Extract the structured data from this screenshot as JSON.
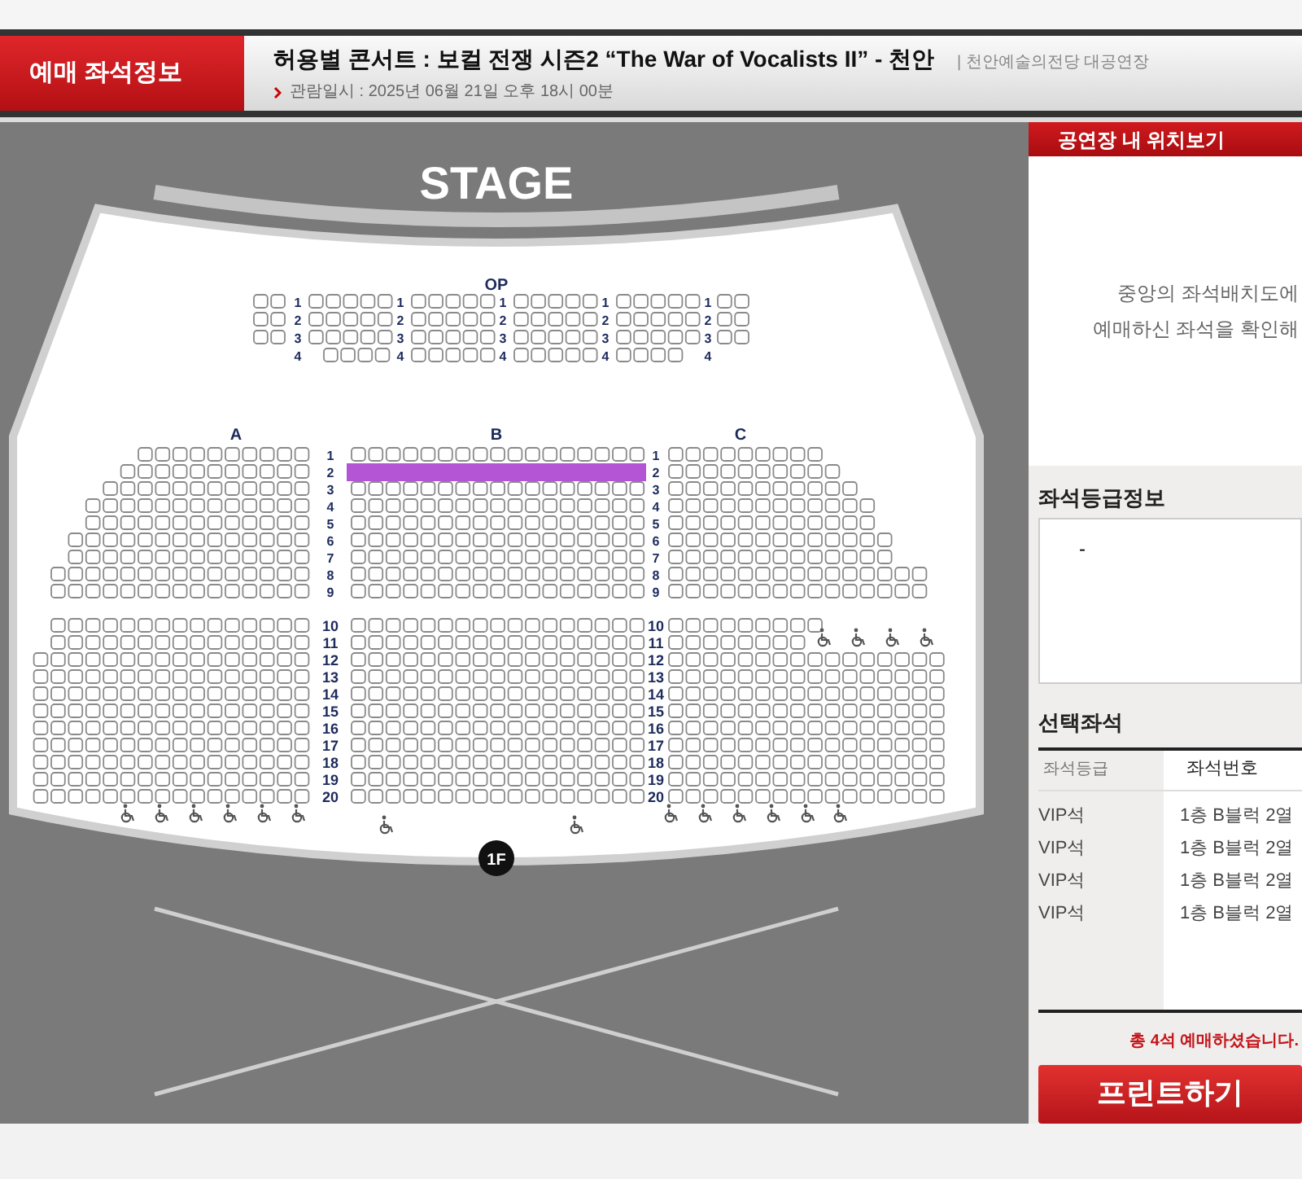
{
  "header": {
    "section_title": "예매 좌석정보",
    "event_title": "허용별 콘서트 : 보컬 전쟁 시즌2 “The War of Vocalists II” - 천안",
    "venue": "| 천안예술의전당 대공연장",
    "date": "관람일시 : 2025년 06월 21일 오후 18시 00분"
  },
  "seat_map": {
    "stage": "STAGE",
    "op_label": "OP",
    "floor": "1F",
    "op_rows": [
      {
        "labels": [
          "1",
          "1",
          "1",
          "1",
          "1"
        ]
      },
      {
        "labels": [
          "2",
          "2",
          "2",
          "2",
          "2"
        ]
      },
      {
        "labels": [
          "3",
          "3",
          "3",
          "3",
          "3"
        ]
      },
      {
        "labels": [
          "4",
          "4",
          "4",
          "4",
          "4"
        ]
      }
    ],
    "sections": [
      "A",
      "B",
      "C"
    ],
    "rows": [
      {
        "left_label": "1",
        "right_label": "1",
        "highlighted": false
      },
      {
        "left_label": "2",
        "right_label": "2",
        "highlighted": true
      },
      {
        "left_label": "3",
        "right_label": "3",
        "highlighted": false
      },
      {
        "left_label": "4",
        "right_label": "4",
        "highlighted": false
      },
      {
        "left_label": "5",
        "right_label": "5",
        "highlighted": false
      },
      {
        "left_label": "6",
        "right_label": "6",
        "highlighted": false
      },
      {
        "left_label": "7",
        "right_label": "7",
        "highlighted": false
      },
      {
        "left_label": "8",
        "right_label": "8",
        "highlighted": false
      },
      {
        "left_label": "9",
        "right_label": "9",
        "highlighted": false
      },
      {
        "left_label": "10",
        "right_label": "10",
        "highlighted": false
      },
      {
        "left_label": "11",
        "right_label": "11",
        "highlighted": false
      },
      {
        "left_label": "12",
        "right_label": "12",
        "highlighted": false
      },
      {
        "left_label": "13",
        "right_label": "13",
        "highlighted": false
      },
      {
        "left_label": "14",
        "right_label": "14",
        "highlighted": false
      },
      {
        "left_label": "15",
        "right_label": "15",
        "highlighted": false
      },
      {
        "left_label": "16",
        "right_label": "16",
        "highlighted": false
      },
      {
        "left_label": "17",
        "right_label": "17",
        "highlighted": false
      },
      {
        "left_label": "18",
        "right_label": "18",
        "highlighted": false
      },
      {
        "left_label": "19",
        "right_label": "19",
        "highlighted": false
      },
      {
        "left_label": "20",
        "right_label": "20",
        "highlighted": false
      }
    ]
  },
  "side_panel": {
    "location_title": "공연장 내 위치보기",
    "location_message": [
      "중앙의 좌석배치도에",
      "예매하신 좌석을 확인해"
    ],
    "grade_title": "좌석등급정보",
    "grade_info": "-",
    "selected_title": "선택좌석",
    "columns": [
      "좌석등급",
      "좌석번호"
    ],
    "selected_seats": [
      {
        "grade": "VIP석",
        "seat": "1층 B블럭 2열"
      },
      {
        "grade": "VIP석",
        "seat": "1층 B블럭 2열"
      },
      {
        "grade": "VIP석",
        "seat": "1층 B블럭 2열"
      },
      {
        "grade": "VIP석",
        "seat": "1층 B블럭 2열"
      }
    ],
    "total": "총 4석 예매하셨습니다.",
    "print_button": "프린트하기"
  }
}
